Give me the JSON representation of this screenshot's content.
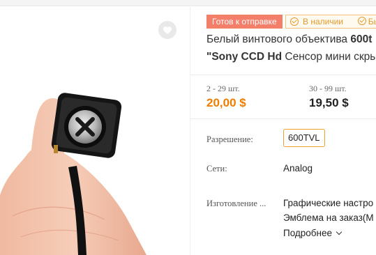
{
  "product": {
    "badges": {
      "ready": "Готов к отправке",
      "stock": "В наличии",
      "fast": "Быст"
    },
    "title": {
      "line1_plain": "Белый винтового объектива ",
      "line1_bold": "600t",
      "line2_bold": "\"Sony CCD Hd",
      "line2_plain": " Сенсор мини скрыт"
    },
    "price_tiers": [
      {
        "range": "2 - 29 шт.",
        "price": "20,00 $"
      },
      {
        "range": "30 - 99 шт.",
        "price": "19,50 $"
      }
    ],
    "specs": {
      "resolution_label": "Разрешение:",
      "resolution_value": "600TVL",
      "network_label": "Сети:",
      "network_value": "Analog",
      "manufacturing_label": "Изготовление ...",
      "manufacturing_line1": "Графические настро",
      "manufacturing_line2": "Эмблема на заказ(М"
    },
    "more_label": "Подробнее"
  },
  "colors": {
    "price_accent": "#f07c00",
    "badge_ready_bg": "#f37e6a",
    "badge_stock": "#e59a2c",
    "selected_border": "#f0a030"
  },
  "icons": {
    "favorite": "heart-icon",
    "stock": "check-circle-icon",
    "more": "chevron-down-icon"
  }
}
